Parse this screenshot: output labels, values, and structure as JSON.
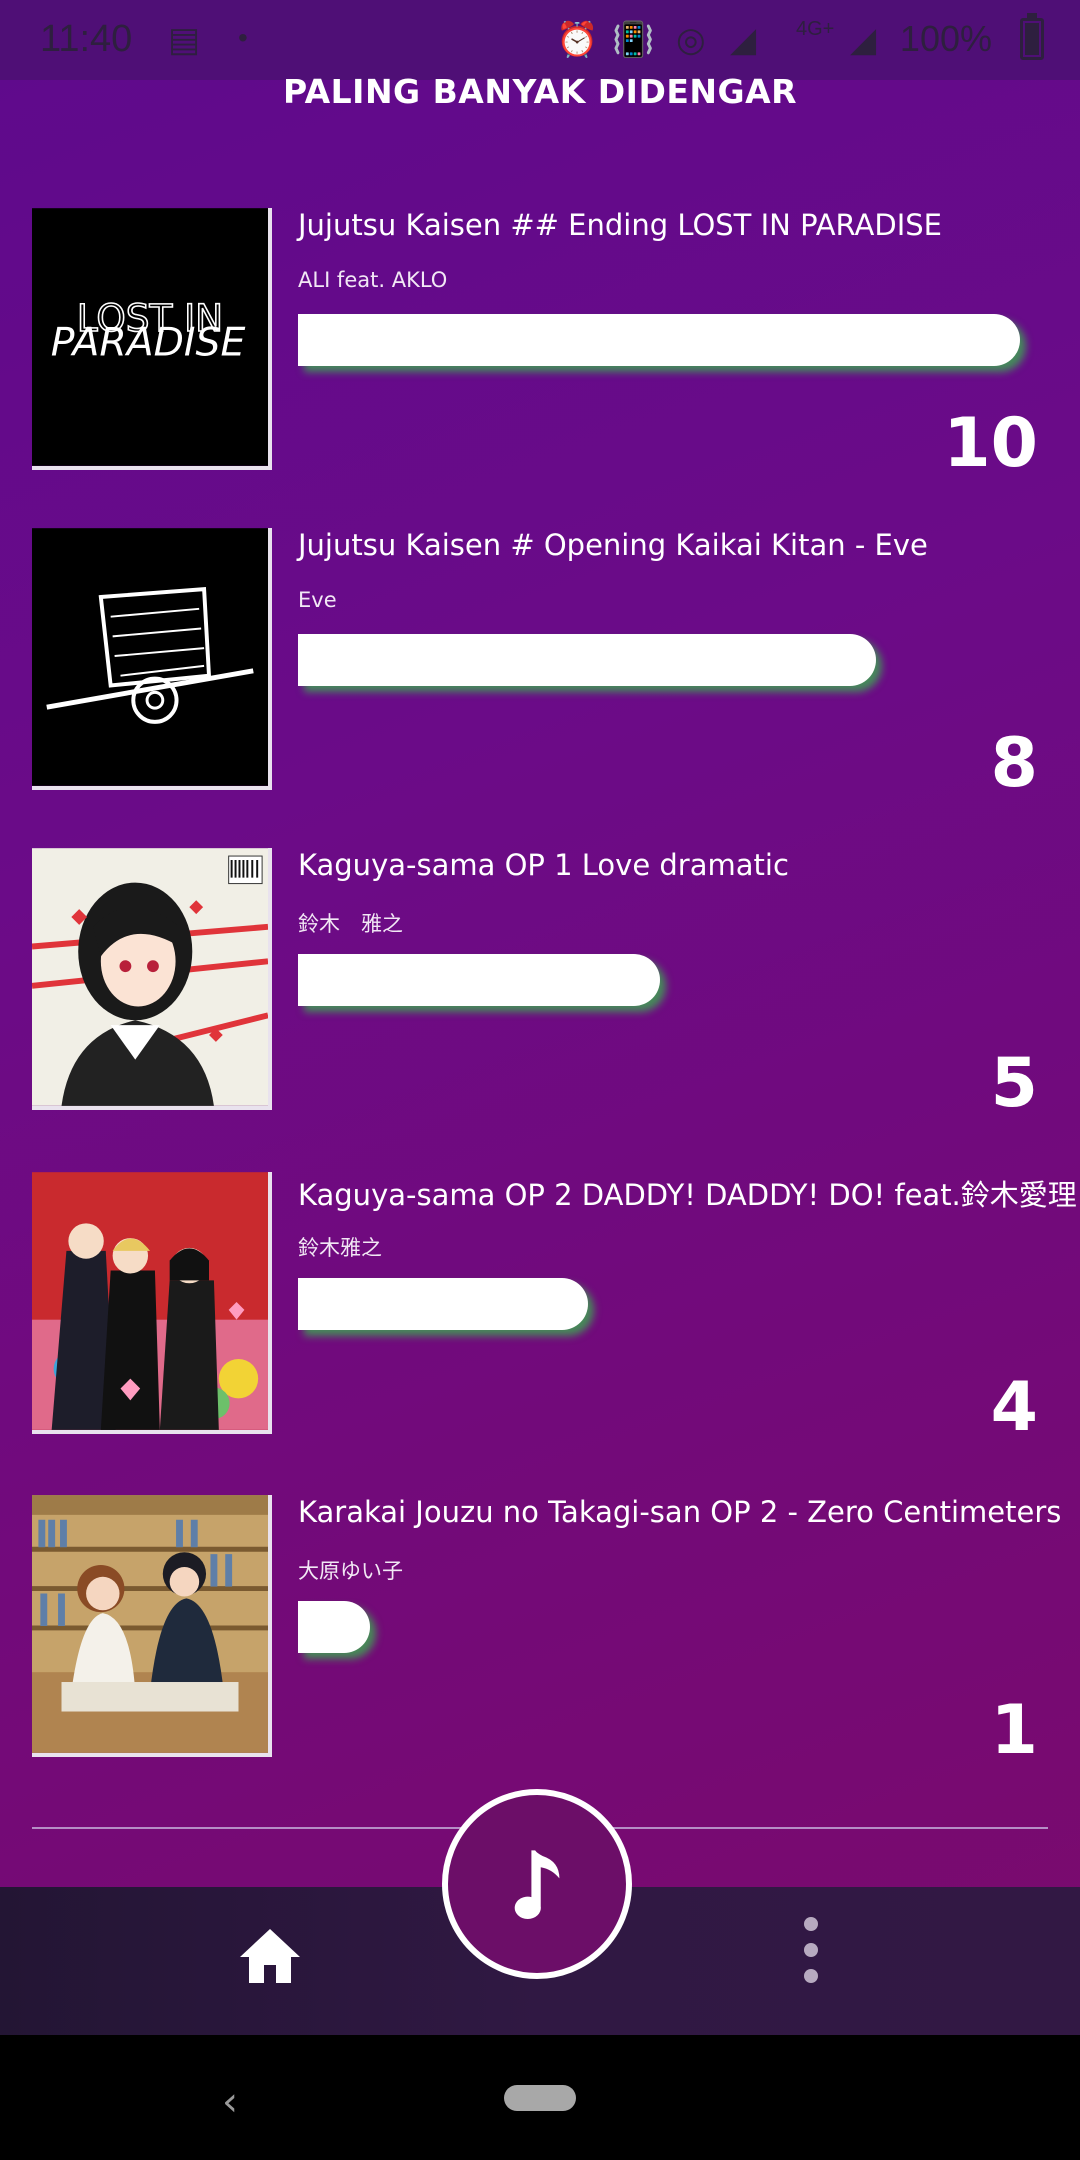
{
  "status_bar": {
    "time": "11:40",
    "network": "4G+",
    "battery": "100%"
  },
  "page_title": "PALING BANYAK DIDENGAR",
  "songs": [
    {
      "title": "Jujutsu Kaisen ## Ending LOST IN PARADISE",
      "artist": "ALI feat. AKLO",
      "plays": "10",
      "play_fraction": 0.73,
      "cover_text": "LOST IN PARADISE"
    },
    {
      "title": "Jujutsu Kaisen # Opening Kaikai Kitan - Eve",
      "artist": "Eve",
      "plays": "8",
      "play_fraction": 0.59
    },
    {
      "title": "Kaguya-sama OP 1 Love dramatic",
      "artist": "鈴木　雅之",
      "plays": "5",
      "play_fraction": 0.37
    },
    {
      "title": "Kaguya-sama OP 2 DADDY! DADDY! DO! feat.鈴木愛理",
      "artist": "鈴木雅之",
      "plays": "4",
      "play_fraction": 0.29
    },
    {
      "title": "Karakai Jouzu no Takagi-san OP 2 - Zero Centimeters",
      "artist": "大原ゆい子",
      "plays": "1",
      "play_fraction": 0.07
    }
  ],
  "nav": {
    "home_icon": "home-icon",
    "music_icon": "music-note-icon",
    "more_icon": "more-vert-icon"
  },
  "colors": {
    "bar_fill": "#ffffff",
    "bar_shadow": "#3caa50",
    "fab_bg": "#6c0e68"
  }
}
